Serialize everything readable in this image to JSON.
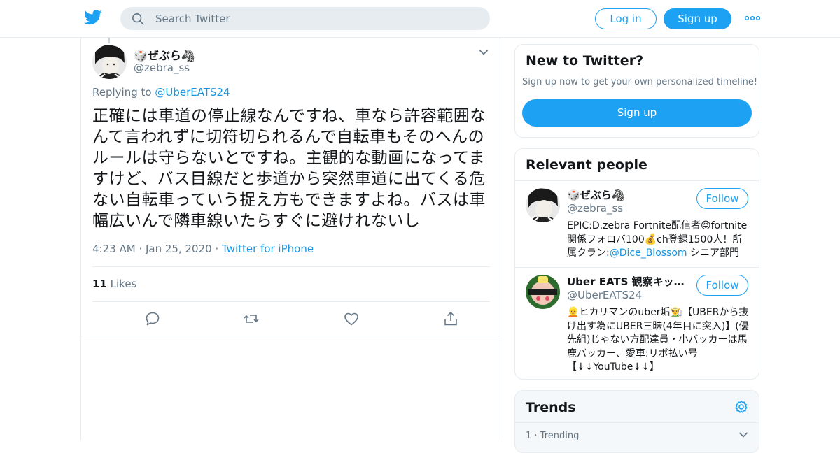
{
  "nav": {
    "search_placeholder": "Search Twitter",
    "login_label": "Log in",
    "signup_label": "Sign up"
  },
  "tweet": {
    "display_name": "🎲ぜぶら🦓",
    "handle": "@zebra_ss",
    "replying_prefix": "Replying to ",
    "replying_to": "@UberEATS24",
    "text": "正確には車道の停止線なんですね、車なら許容範囲なんて言われずに切符切られるんで自転車もそのへんのルールは守らないとですね。主観的な動画になってますけど、バス目線だと歩道から突然車道に出てくる危ない自転車っていう捉え方もできますよね。バスは車幅広いんで隣車線いたらすぐに避けれないし",
    "time": "4:23 AM",
    "date": "Jan 25, 2020",
    "source": "Twitter for iPhone",
    "likes_count": "11",
    "likes_label": "Likes"
  },
  "new_to_twitter": {
    "title": "New to Twitter?",
    "subtitle": "Sign up now to get your own personalized timeline!",
    "button": "Sign up"
  },
  "relevant_people": {
    "title": "Relevant people",
    "people": [
      {
        "name": "🎲ぜぶら🦓",
        "handle": "@zebra_ss",
        "follow_label": "Follow",
        "bio_before": "EPIC:D.zebra Fortnite配信者😝fortnite関係フォロバ100💰ch登録1500人！所属クラン:",
        "bio_mention": "@Dice_Blossom",
        "bio_after": " シニア部門"
      },
      {
        "name": "Uber EATS 観察キット(Hikaryman)",
        "handle": "@UberEATS24",
        "follow_label": "Follow",
        "bio_before": "👱ヒカリマンのuber垢👨‍🌾【UBERから抜け出す為にUBER三昧(4年目に突入)】(優先組)じゃない方配達員・小バッカーは馬鹿バッカー、愛車:リボ払い号【↓↓YouTube↓↓】",
        "bio_mention": "",
        "bio_after": ""
      }
    ]
  },
  "trends": {
    "title": "Trends",
    "first_meta": "1 · Trending"
  },
  "colors": {
    "accent": "#1da1f2",
    "link": "#1b95e0",
    "muted": "#657786",
    "border": "#e6ecf0"
  }
}
